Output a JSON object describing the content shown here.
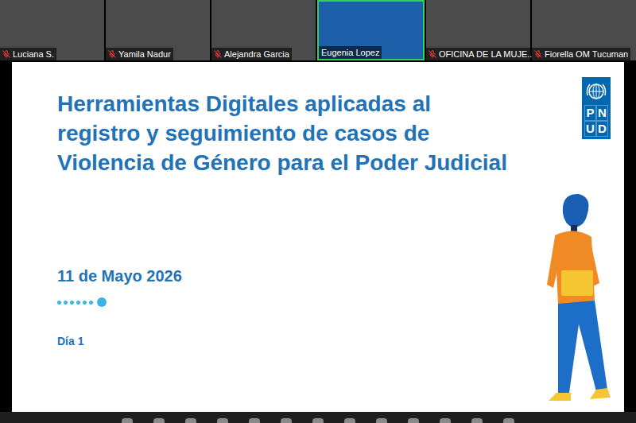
{
  "participants": [
    {
      "name": "Luciana S.",
      "muted": true,
      "active": false
    },
    {
      "name": "Yamila Nadur",
      "muted": true,
      "active": false
    },
    {
      "name": "Alejandra Garcia",
      "muted": true,
      "active": false
    },
    {
      "name": "Eugenia Lopez",
      "muted": false,
      "active": true
    },
    {
      "name": "OFICINA DE LA MUJE...",
      "muted": true,
      "active": false
    },
    {
      "name": "Fiorella OM Tucuman",
      "muted": true,
      "active": false
    }
  ],
  "slide": {
    "title": "Herramientas Digitales aplicadas al registro y seguimiento de casos de Violencia de Género para el Poder Judicial",
    "date": "11 de Mayo 2026",
    "day": "Día 1",
    "logo_letters": [
      "P",
      "N",
      "U",
      "D"
    ],
    "progress": [
      {
        "selected": false
      },
      {
        "selected": false
      },
      {
        "selected": false
      },
      {
        "selected": false
      },
      {
        "selected": false
      },
      {
        "selected": false
      },
      {
        "selected": true
      }
    ]
  }
}
